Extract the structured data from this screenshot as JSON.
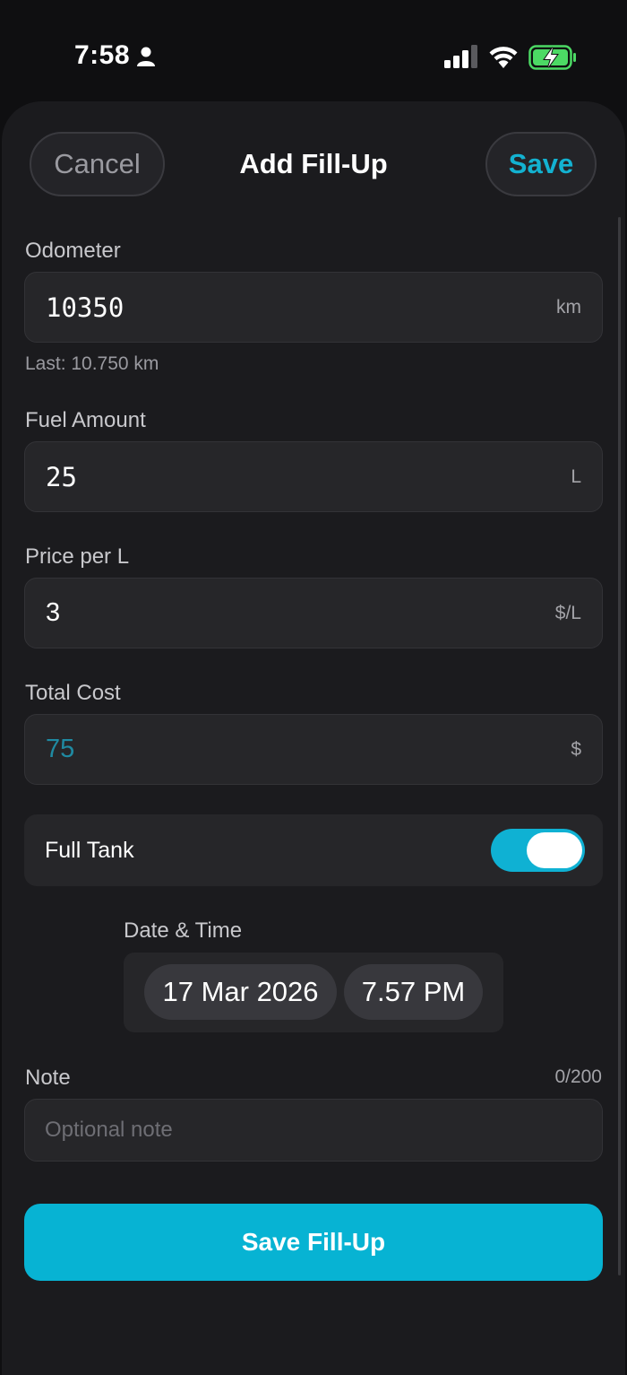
{
  "status_bar": {
    "time": "7:58",
    "icons": [
      "person-icon",
      "signal-icon",
      "wifi-icon",
      "battery-charging-icon"
    ],
    "battery_color": "#4cd964"
  },
  "header": {
    "cancel_label": "Cancel",
    "title": "Add Fill-Up",
    "save_label": "Save"
  },
  "form": {
    "odometer": {
      "label": "Odometer",
      "value": "10350",
      "unit": "km",
      "hint": "Last: 10.750 km"
    },
    "fuel_amount": {
      "label": "Fuel Amount",
      "value": "25",
      "unit": "L"
    },
    "price_per_l": {
      "label": "Price per L",
      "value": "3",
      "unit": "$/L"
    },
    "total_cost": {
      "label": "Total Cost",
      "value": "75",
      "unit": "$"
    },
    "full_tank": {
      "label": "Full Tank",
      "enabled": true
    },
    "date_time": {
      "label": "Date & Time",
      "date": "17 Mar 2026",
      "time": "7.57 PM"
    },
    "note": {
      "label": "Note",
      "count": "0/200",
      "placeholder": "Optional note",
      "value": ""
    }
  },
  "primary_button": {
    "label": "Save Fill-Up"
  },
  "colors": {
    "accent": "#07b3d3",
    "background": "#0f0f11",
    "sheet": "#1b1b1e",
    "field": "#262629"
  }
}
